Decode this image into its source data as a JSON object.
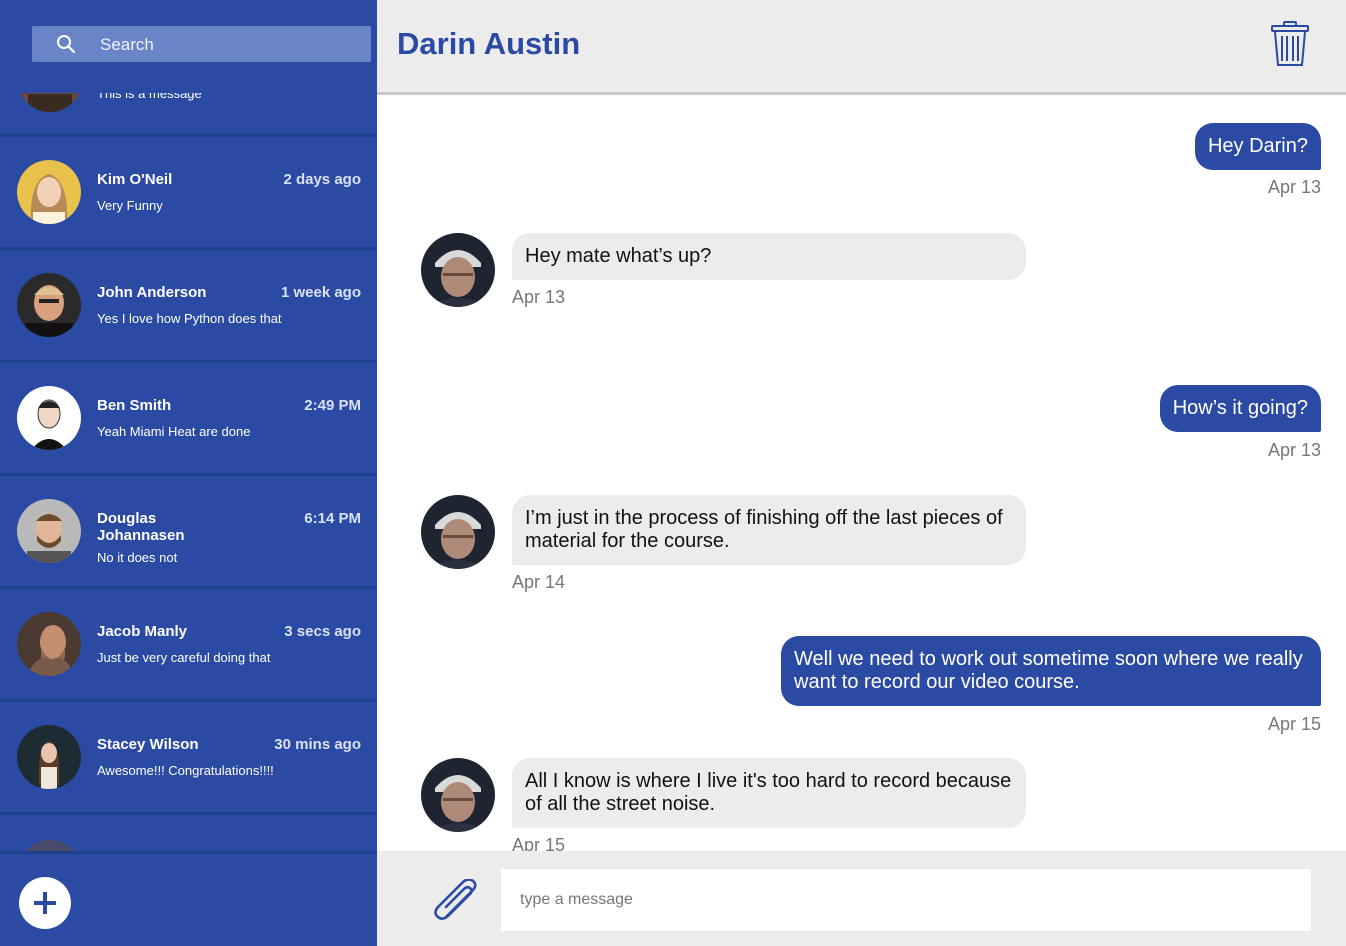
{
  "sidebar": {
    "search": {
      "label": "Search",
      "icon": "search-icon"
    },
    "partial_top": {
      "message": "This is a message"
    },
    "conversations": [
      {
        "name": "Kim O'Neil",
        "time": "2 days ago",
        "message": "Very Funny",
        "avatar_bg": "#e8c24a"
      },
      {
        "name": "John Anderson",
        "time": "1 week ago",
        "message": "Yes I love how Python does that",
        "avatar_bg": "#3b3b3b"
      },
      {
        "name": "Ben Smith",
        "time": "2:49 PM",
        "message": "Yeah Miami Heat are done",
        "avatar_bg": "#ffffff"
      },
      {
        "name": "Douglas Johannasen",
        "time": "6:14 PM",
        "message": "No it does not",
        "avatar_bg": "#b9b9b9"
      },
      {
        "name": "Jacob Manly",
        "time": "3 secs ago",
        "message": "Just be very careful doing that",
        "avatar_bg": "#5a4a40"
      },
      {
        "name": "Stacey Wilson",
        "time": "30 mins ago",
        "message": "Awesome!!! Congratulations!!!!",
        "avatar_bg": "#1d2b33"
      }
    ],
    "new_button": {
      "icon": "plus-icon"
    }
  },
  "chat": {
    "title": "Darin Austin",
    "delete_icon": "trash-icon",
    "messages": [
      {
        "direction": "out",
        "text": "Hey Darin?",
        "date": "Apr 13"
      },
      {
        "direction": "in",
        "text": "Hey mate what’s up?",
        "date": "Apr 13"
      },
      {
        "direction": "out",
        "text": "How’s it going?",
        "date": "Apr 13"
      },
      {
        "direction": "in",
        "text": "I’m just in the process of finishing off the last pieces of material for the course.",
        "date": "Apr 14"
      },
      {
        "direction": "out",
        "text": "Well we need to work out sometime soon where we really want to record our video course.",
        "date": "Apr 15"
      },
      {
        "direction": "in",
        "text": "All I know is where I live it's too hard to record because of all the street noise.",
        "date": "Apr 15"
      }
    ],
    "composer": {
      "placeholder": "type a message",
      "attach_icon": "paperclip-icon"
    }
  },
  "colors": {
    "brand": "#2b4aa3",
    "incoming_bubble": "#ececec",
    "header_bg": "#ececec"
  }
}
